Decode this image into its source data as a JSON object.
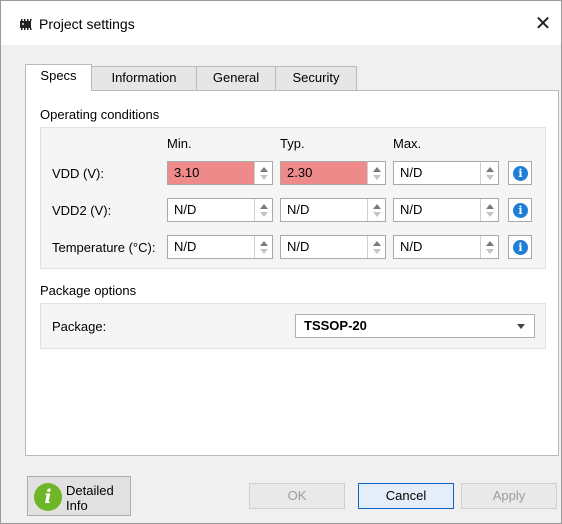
{
  "window": {
    "title": "Project settings",
    "close_glyph": "✕"
  },
  "tabs": [
    {
      "label": "Specs",
      "active": true
    },
    {
      "label": "Information",
      "active": false
    },
    {
      "label": "General",
      "active": false
    },
    {
      "label": "Security",
      "active": false
    }
  ],
  "operating_conditions": {
    "title": "Operating conditions",
    "columns": [
      "Min.",
      "Typ.",
      "Max."
    ],
    "rows": [
      {
        "label": "VDD (V):",
        "min": "3.10",
        "typ": "2.30",
        "max": "N/D",
        "min_error": true,
        "typ_error": true
      },
      {
        "label": "VDD2 (V):",
        "min": "N/D",
        "typ": "N/D",
        "max": "N/D"
      },
      {
        "label": "Temperature (°C):",
        "min": "N/D",
        "typ": "N/D",
        "max": "N/D"
      }
    ],
    "info_icon_glyph": "i"
  },
  "package_options": {
    "title": "Package options",
    "label": "Package:",
    "selected": "TSSOP-20"
  },
  "footer": {
    "detailed_info_line1": "Detailed",
    "detailed_info_line2": "Info",
    "detail_icon_glyph": "i",
    "ok_label": "OK",
    "cancel_label": "Cancel",
    "apply_label": "Apply"
  },
  "colors": {
    "error_fill": "#ee8a8a",
    "info_blue": "#1f7fd6",
    "info_green": "#6fb528",
    "default_button_border": "#0a64c8"
  }
}
